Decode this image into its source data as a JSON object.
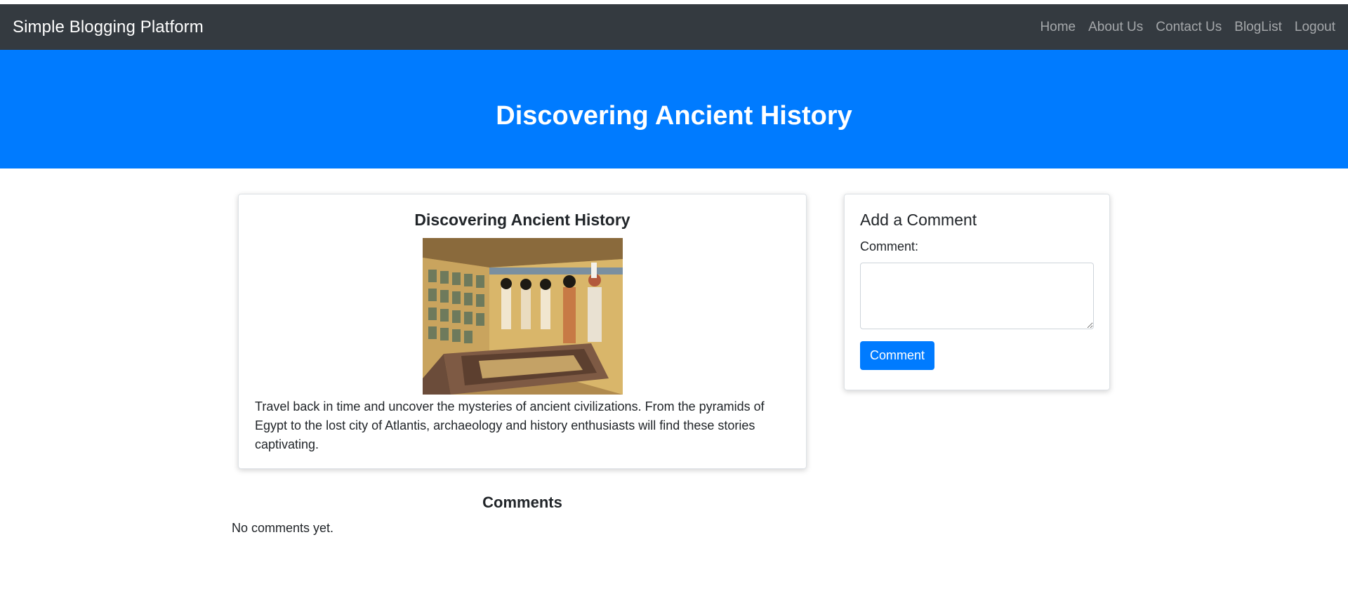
{
  "navbar": {
    "brand": "Simple Blogging Platform",
    "links": [
      "Home",
      "About Us",
      "Contact Us",
      "BlogList",
      "Logout"
    ]
  },
  "hero": {
    "title": "Discovering Ancient History"
  },
  "post": {
    "title": "Discovering Ancient History",
    "body": "Travel back in time and uncover the mysteries of ancient civilizations. From the pyramids of Egypt to the lost city of Atlantis, archaeology and history enthusiasts will find these stories captivating."
  },
  "comment_form": {
    "heading": "Add a Comment",
    "label": "Comment:",
    "textarea_value": "",
    "button_label": "Comment"
  },
  "comments": {
    "heading": "Comments",
    "empty_text": "No comments yet."
  },
  "colors": {
    "navbar_bg": "#343a40",
    "accent": "#007bff"
  }
}
